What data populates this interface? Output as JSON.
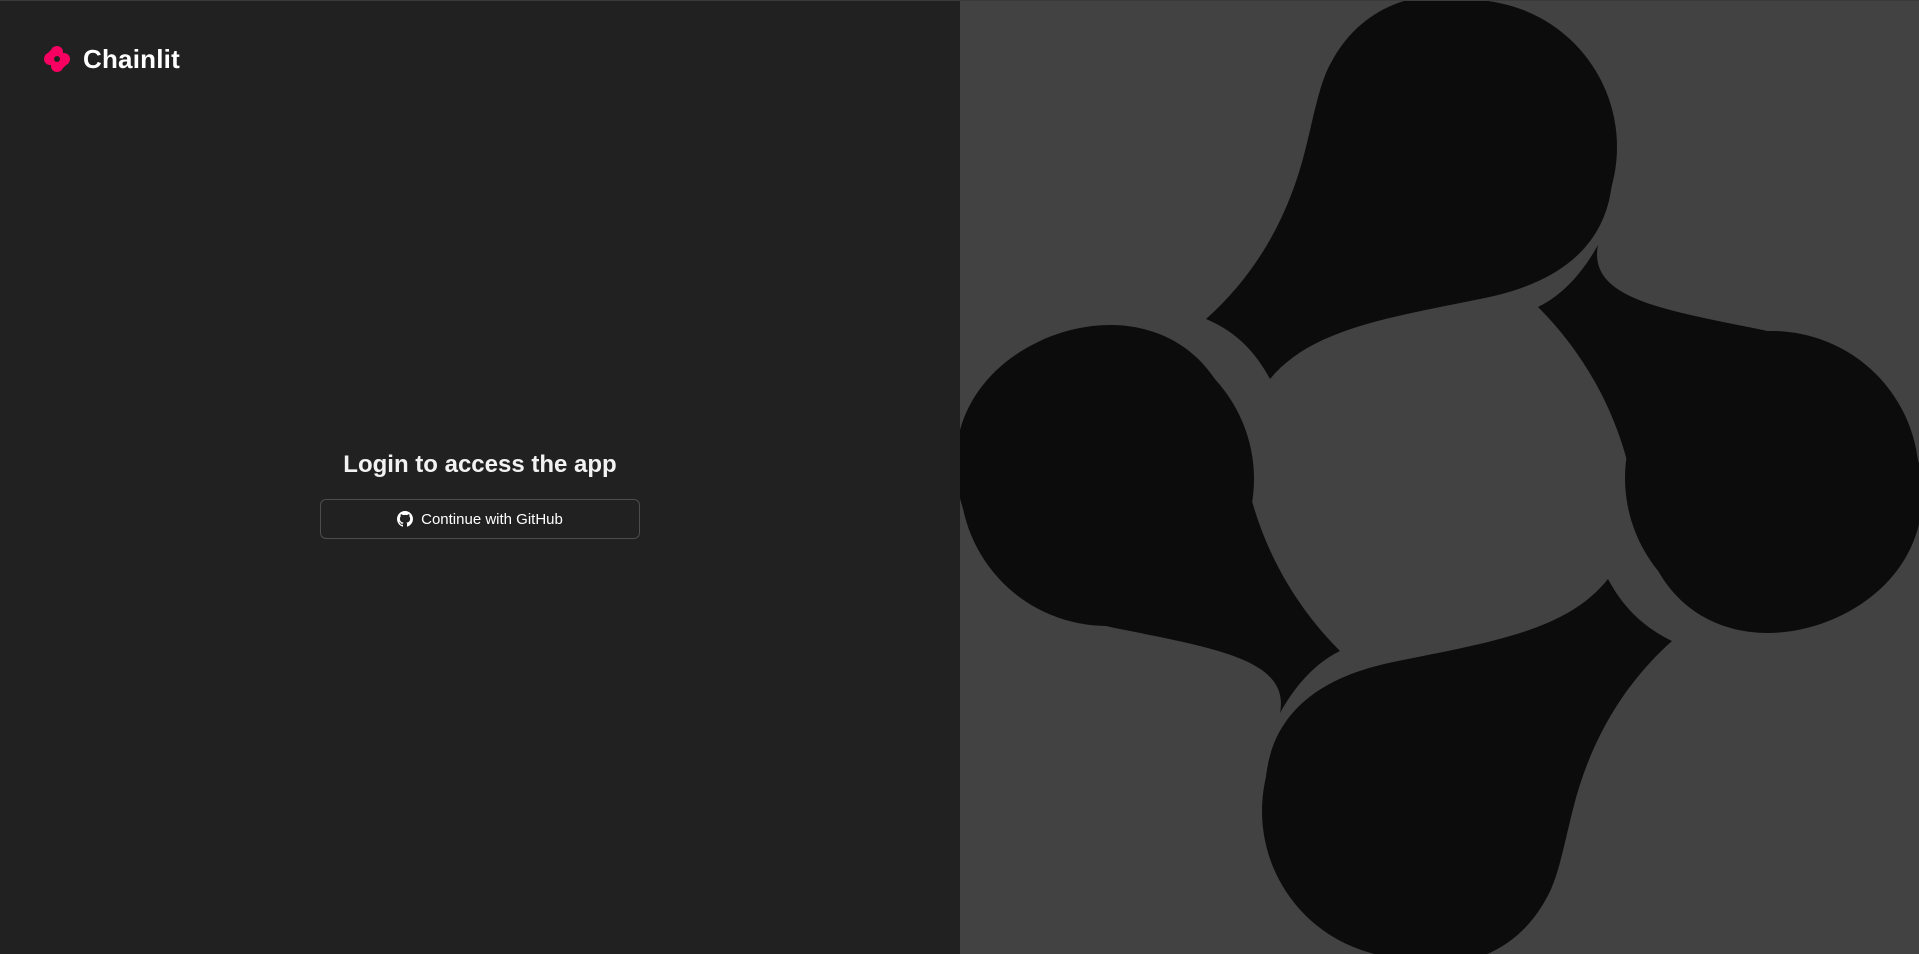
{
  "brand": {
    "name": "Chainlit",
    "accent_color": "#F80061",
    "icon": "chainlit-logo-icon"
  },
  "login": {
    "title": "Login to access the app",
    "providers": [
      {
        "label": "Continue with GitHub",
        "icon": "github-icon"
      }
    ]
  },
  "colors": {
    "left_background": "#212121",
    "right_background": "#424242",
    "petal_color": "#0C0C0C"
  }
}
